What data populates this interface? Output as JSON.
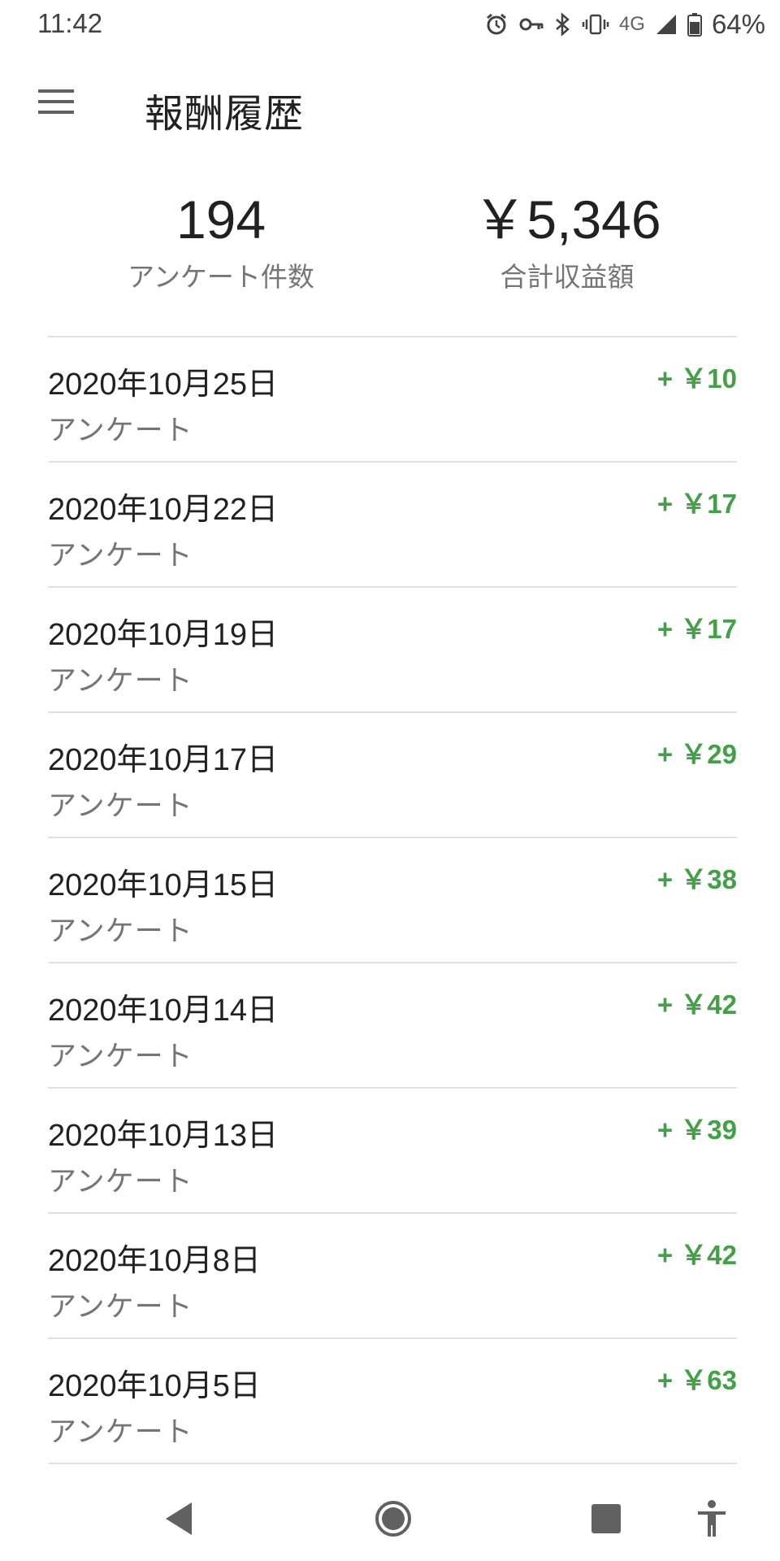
{
  "status_bar": {
    "time": "11:42",
    "network": "4G",
    "battery": "64%",
    "icons": [
      "alarm-icon",
      "vpn-key-icon",
      "bluetooth-icon",
      "vibrate-icon",
      "signal-icon",
      "battery-icon"
    ]
  },
  "header": {
    "menu_icon": "menu-icon",
    "title": "報酬履歴"
  },
  "summary": {
    "count_value": "194",
    "count_label": "アンケート件数",
    "total_value": "￥5,346",
    "total_label": "合計収益額"
  },
  "history": [
    {
      "date": "2020年10月25日",
      "type": "アンケート",
      "amount": "+ ￥10"
    },
    {
      "date": "2020年10月22日",
      "type": "アンケート",
      "amount": "+ ￥17"
    },
    {
      "date": "2020年10月19日",
      "type": "アンケート",
      "amount": "+ ￥17"
    },
    {
      "date": "2020年10月17日",
      "type": "アンケート",
      "amount": "+ ￥29"
    },
    {
      "date": "2020年10月15日",
      "type": "アンケート",
      "amount": "+ ￥38"
    },
    {
      "date": "2020年10月14日",
      "type": "アンケート",
      "amount": "+ ￥42"
    },
    {
      "date": "2020年10月13日",
      "type": "アンケート",
      "amount": "+ ￥39"
    },
    {
      "date": "2020年10月8日",
      "type": "アンケート",
      "amount": "+ ￥42"
    },
    {
      "date": "2020年10月5日",
      "type": "アンケート",
      "amount": "+ ￥63"
    }
  ],
  "colors": {
    "amount_green": "#43a047",
    "divider": "#e0e0e0",
    "secondary_text": "#757575"
  },
  "nav_bar": [
    "back-icon",
    "home-icon",
    "recents-icon",
    "accessibility-icon"
  ]
}
